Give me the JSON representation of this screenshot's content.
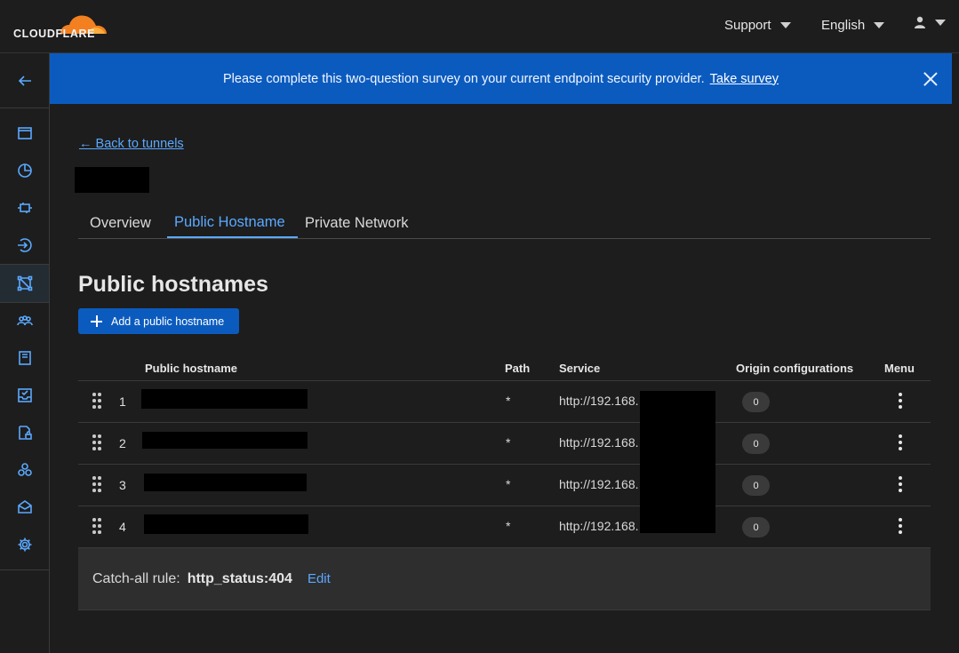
{
  "header": {
    "logo_text": "CLOUDFLARE",
    "support_label": "Support",
    "language_label": "English",
    "user_icon": "user-icon"
  },
  "banner": {
    "message": "Please complete this two-question survey on your current endpoint security provider.",
    "link_label": "Take survey"
  },
  "nav": {
    "back_link": "← Back to tunnels"
  },
  "tabs": [
    {
      "label": "Overview"
    },
    {
      "label": "Public Hostname"
    },
    {
      "label": "Private Network"
    }
  ],
  "section": {
    "title": "Public hostnames",
    "add_button": "Add a public hostname"
  },
  "table": {
    "columns": [
      "Public hostname",
      "Path",
      "Service",
      "Origin configurations",
      "Menu"
    ],
    "rows": [
      {
        "num": "1",
        "path": "*",
        "service": "http://192.168.",
        "origin": "0"
      },
      {
        "num": "2",
        "path": "*",
        "service": "http://192.168.",
        "origin": "0"
      },
      {
        "num": "3",
        "path": "*",
        "service": "http://192.168.",
        "origin": "0"
      },
      {
        "num": "4",
        "path": "*",
        "service": "http://192.168.",
        "origin": "0"
      }
    ]
  },
  "catchall": {
    "label": "Catch-all rule:",
    "value": "http_status:404",
    "edit_label": "Edit"
  },
  "colors": {
    "accent": "#0b5bbf",
    "link": "#5aa9ff",
    "logo_orange": "#f38020"
  }
}
